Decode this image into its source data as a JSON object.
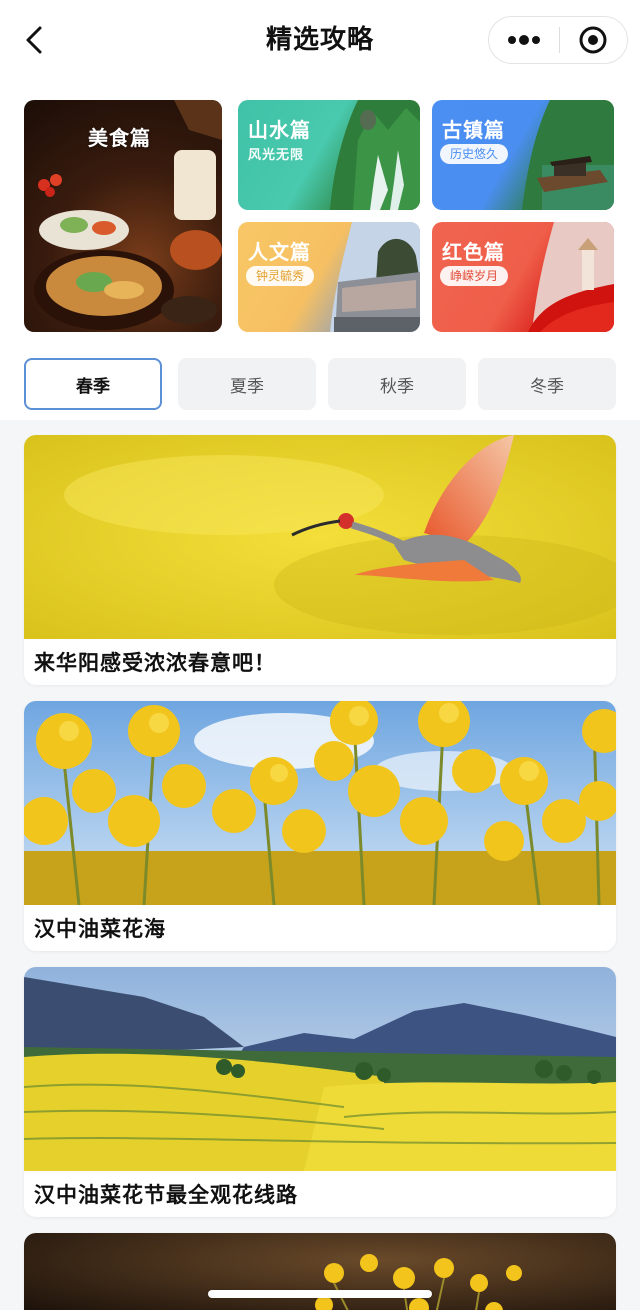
{
  "nav": {
    "title": "精选攻略",
    "back_icon": "chevron-left-icon",
    "more_icon": "more-dots-icon",
    "close_icon": "target-close-icon"
  },
  "categories": [
    {
      "title": "美食篇",
      "subtitle": ""
    },
    {
      "title": "山水篇",
      "subtitle": "风光无限"
    },
    {
      "title": "古镇篇",
      "subtitle": "历史悠久"
    },
    {
      "title": "人文篇",
      "subtitle": "钟灵毓秀"
    },
    {
      "title": "红色篇",
      "subtitle": "峥嵘岁月"
    }
  ],
  "tabs": [
    {
      "label": "春季",
      "active": true
    },
    {
      "label": "夏季",
      "active": false
    },
    {
      "label": "秋季",
      "active": false
    },
    {
      "label": "冬季",
      "active": false
    }
  ],
  "cards": [
    {
      "title": "来华阳感受浓浓春意吧！"
    },
    {
      "title": "汉中油菜花海"
    },
    {
      "title": "汉中油菜花节最全观花线路"
    },
    {
      "title": ""
    }
  ],
  "colors": {
    "active_tab_border": "#5b8fd6",
    "rapeseed_yellow": "#f2d21f"
  }
}
